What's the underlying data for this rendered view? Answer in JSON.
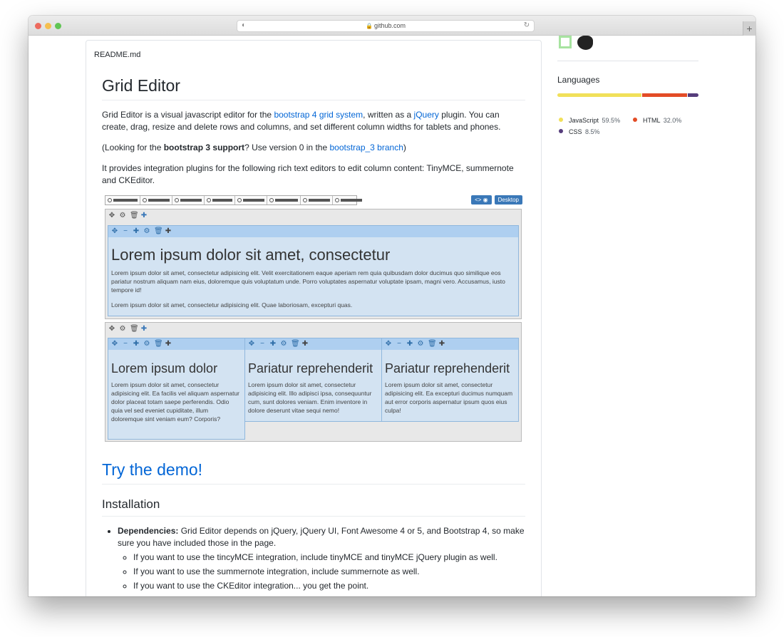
{
  "browser": {
    "address": "github.com",
    "lock_icon": "lock-icon",
    "reload_icon": "reload-icon",
    "newtab_icon": "plus-icon"
  },
  "readme": {
    "filename": "README.md",
    "title": "Grid Editor",
    "intro": {
      "p1_a": "Grid Editor is a visual javascript editor for the ",
      "p1_link1": "bootstrap 4 grid system",
      "p1_b": ", written as a ",
      "p1_link2": "jQuery",
      "p1_c": " plugin. You can create, drag, resize and delete rows and columns, and set different column widths for tablets and phones.",
      "p2_a": "(Looking for the ",
      "p2_bold": "bootstrap 3 support",
      "p2_b": "? Use version 0 in the ",
      "p2_link": "bootstrap_3 branch",
      "p2_c": ")",
      "p3": "It provides integration plugins for the following rich text editors to edit column content: TinyMCE, summernote and CKEditor."
    },
    "screenshot": {
      "desktop_label": "Desktop",
      "row1": {
        "heading": "Lorem ipsum dolor sit amet, consectetur",
        "para1": "Lorem ipsum dolor sit amet, consectetur adipisicing elit. Velit exercitationem eaque aperiam rem quia quibusdam dolor ducimus quo similique eos pariatur nostrum aliquam nam eius, doloremque quis voluptatum unde. Porro voluptates aspernatur voluptate ipsam, magni vero. Accusamus, iusto tempore id!",
        "para2": "Lorem ipsum dolor sit amet, consectetur adipisicing elit. Quae laboriosam, excepturi quas."
      },
      "row2": [
        {
          "heading": "Lorem ipsum dolor",
          "para": "Lorem ipsum dolor sit amet, consectetur adipisicing elit. Ea facilis vel aliquam aspernatur dolor placeat totam saepe perferendis. Odio quia vel sed eveniet cupiditate, illum doloremque sint veniam eum? Corporis?"
        },
        {
          "heading": "Pariatur reprehenderit",
          "para": "Lorem ipsum dolor sit amet, consectetur adipisicing elit. Illo adipisci ipsa, consequuntur cum, sunt dolores veniam. Enim inventore in dolore deserunt vitae sequi nemo!"
        },
        {
          "heading": "Pariatur reprehenderit",
          "para": "Lorem ipsum dolor sit amet, consectetur adipisicing elit. Ea excepturi ducimus numquam aut error corporis aspernatur ipsum quos eius culpa!"
        }
      ]
    },
    "demo_link": "Try the demo!",
    "installation": {
      "title": "Installation",
      "dep_bold": "Dependencies:",
      "dep_text": " Grid Editor depends on jQuery, jQuery UI, Font Awesome 4 or 5, and Bootstrap 4, so make sure you have included those in the page.",
      "sub_items": [
        "If you want to use the tincyMCE integration, include tinyMCE and tinyMCE jQuery plugin as well.",
        "If you want to use the summernote integration, include summernote as well.",
        "If you want to use the CKEditor integration... you get the point."
      ]
    }
  },
  "sidebar": {
    "languages_title": "Languages",
    "languages": [
      {
        "name": "JavaScript",
        "percent": "59.5%",
        "value": 59.5,
        "color": "#f1e05a"
      },
      {
        "name": "HTML",
        "percent": "32.0%",
        "value": 32.0,
        "color": "#e34c26"
      },
      {
        "name": "CSS",
        "percent": "8.5%",
        "value": 8.5,
        "color": "#563d7c"
      }
    ]
  }
}
